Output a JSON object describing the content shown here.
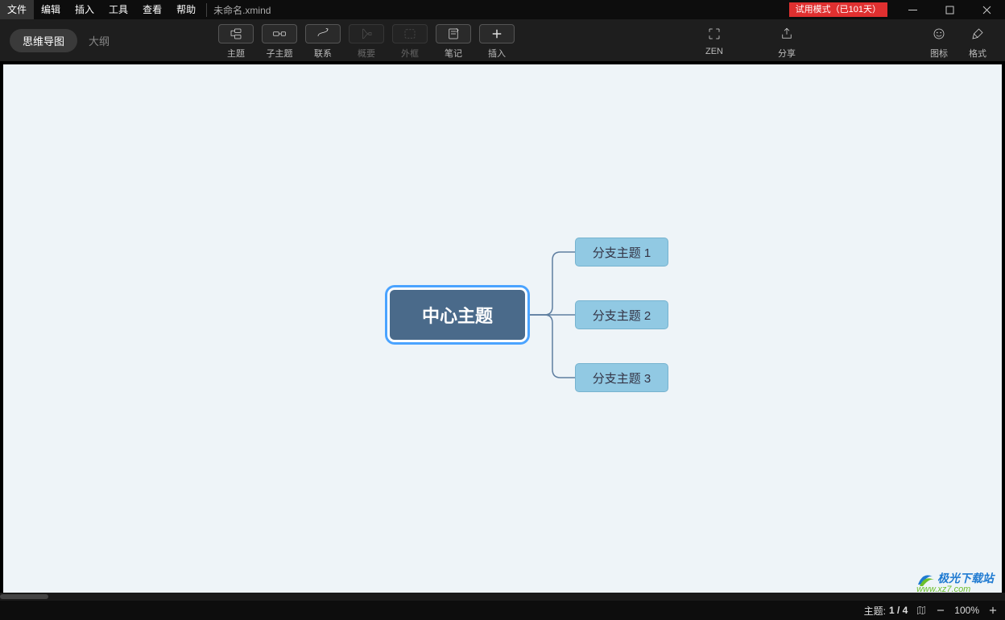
{
  "menu": {
    "items": [
      "文件",
      "编辑",
      "插入",
      "工具",
      "查看",
      "帮助"
    ],
    "doc_title": "未命名.xmind"
  },
  "trial_badge": "试用模式（已101天）",
  "view_switch": {
    "mindmap": "思维导图",
    "outline": "大纲"
  },
  "toolbar": {
    "topic": "主题",
    "subtopic": "子主题",
    "relation": "联系",
    "summary": "概要",
    "boundary": "外框",
    "note": "笔记",
    "insert": "插入",
    "zen": "ZEN",
    "share": "分享",
    "icons": "图标",
    "format": "格式"
  },
  "canvas": {
    "central": "中心主题",
    "branches": [
      "分支主题 1",
      "分支主题 2",
      "分支主题 3"
    ]
  },
  "statusbar": {
    "topic_label": "主题:",
    "topic_count": "1 / 4",
    "zoom": "100%"
  },
  "watermark": {
    "main": "极光下载站",
    "sub": "www.xz7.com"
  },
  "colors": {
    "canvas_bg": "#eef4f8",
    "central_fill": "#4a6a8a",
    "branch_fill": "#91c9e3",
    "accent": "#4aa3ff",
    "trial": "#e03030"
  }
}
